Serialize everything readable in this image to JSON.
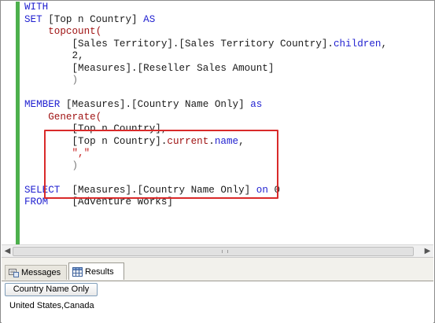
{
  "editor": {
    "lines": [
      [
        {
          "t": "WITH",
          "c": "kw"
        }
      ],
      [
        {
          "t": "SET ",
          "c": "kw"
        },
        {
          "t": "[Top n Country] ",
          "c": "pl"
        },
        {
          "t": "AS",
          "c": "kw"
        }
      ],
      [
        {
          "t": "    topcount(",
          "c": "fn"
        }
      ],
      [
        {
          "t": "        [Sales Territory].[Sales Territory Country].",
          "c": "pl"
        },
        {
          "t": "children",
          "c": "kw"
        },
        {
          "t": ",",
          "c": "pl"
        }
      ],
      [
        {
          "t": "        2,",
          "c": "pl"
        }
      ],
      [
        {
          "t": "        [Measures].[Reseller Sales Amount]",
          "c": "pl"
        }
      ],
      [
        {
          "t": "        )",
          "c": "gy"
        }
      ],
      [
        {
          "t": "",
          "c": "pl"
        }
      ],
      [
        {
          "t": "MEMBER ",
          "c": "kw"
        },
        {
          "t": "[Measures].[Country Name Only] ",
          "c": "pl"
        },
        {
          "t": "as",
          "c": "kw"
        }
      ],
      [
        {
          "t": "    Generate(",
          "c": "fn"
        }
      ],
      [
        {
          "t": "        [Top n Country],",
          "c": "pl"
        }
      ],
      [
        {
          "t": "        [Top n Country].",
          "c": "pl"
        },
        {
          "t": "current",
          "c": "fn"
        },
        {
          "t": ".",
          "c": "pl"
        },
        {
          "t": "name",
          "c": "kw"
        },
        {
          "t": ",",
          "c": "pl"
        }
      ],
      [
        {
          "t": "        \",\"",
          "c": "str"
        }
      ],
      [
        {
          "t": "        )",
          "c": "gy"
        }
      ],
      [
        {
          "t": "",
          "c": "pl"
        }
      ],
      [
        {
          "t": "SELECT  ",
          "c": "kw"
        },
        {
          "t": "[Measures].[Country Name Only] ",
          "c": "pl"
        },
        {
          "t": "on ",
          "c": "kw"
        },
        {
          "t": "0",
          "c": "pl"
        }
      ],
      [
        {
          "t": "FROM    ",
          "c": "kw"
        },
        {
          "t": "[Adventure Works]",
          "c": "pl"
        }
      ]
    ]
  },
  "tabs": {
    "messages_label": "Messages",
    "results_label": "Results"
  },
  "results": {
    "column_header": "Country Name Only",
    "cell_value": "United States,Canada"
  },
  "icons": {
    "messages": "messages-icon",
    "results": "grid-icon"
  },
  "colors": {
    "keyword": "#1f1fd0",
    "function": "#a01414",
    "string": "#c41818",
    "highlight_box": "#d92a2a",
    "gutter": "#4db04d"
  }
}
